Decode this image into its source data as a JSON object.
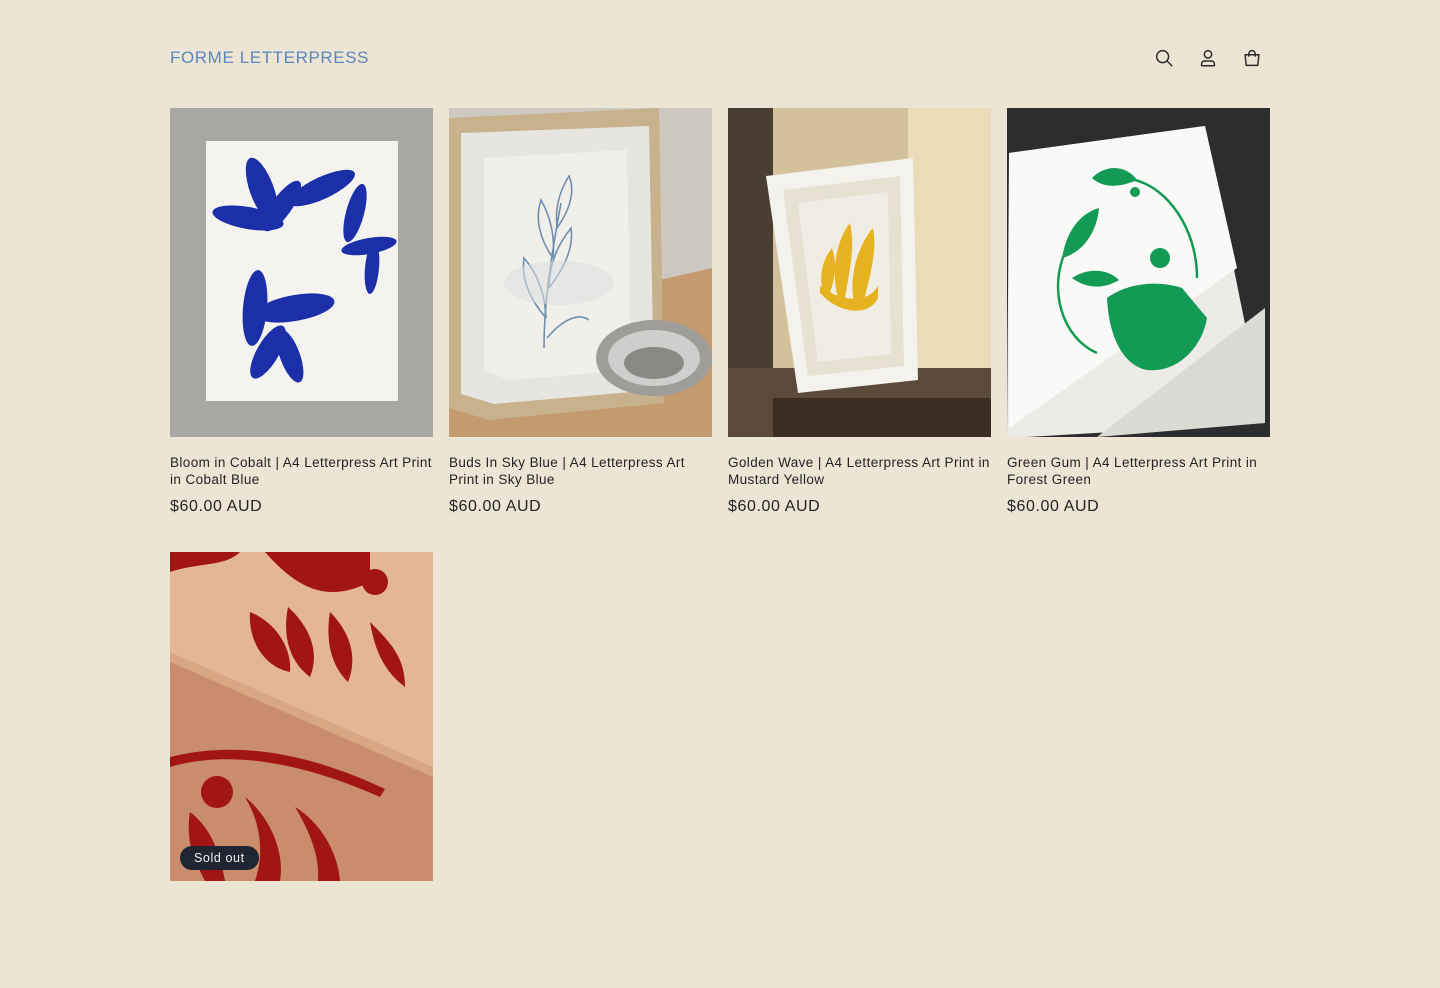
{
  "header": {
    "brand": "FORME LETTERPRESS",
    "icons": [
      "search-icon",
      "account-icon",
      "cart-icon"
    ]
  },
  "products": [
    {
      "title": "Bloom in Cobalt | A4 Letterpress Art Print in Cobalt Blue",
      "price": "$60.00 AUD",
      "accent": "#1b2fa8"
    },
    {
      "title": "Buds In Sky Blue | A4 Letterpress Art Print in Sky Blue",
      "price": "$60.00 AUD",
      "accent": "#6f8fb0"
    },
    {
      "title": "Golden Wave | A4 Letterpress Art Print in Mustard Yellow",
      "price": "$60.00 AUD",
      "accent": "#e7b21f"
    },
    {
      "title": "Green Gum | A4 Letterpress Art Print in Forest Green",
      "price": "$60.00 AUD",
      "accent": "#139a55"
    },
    {
      "badge": "Sold out",
      "accent": "#a11515"
    }
  ]
}
